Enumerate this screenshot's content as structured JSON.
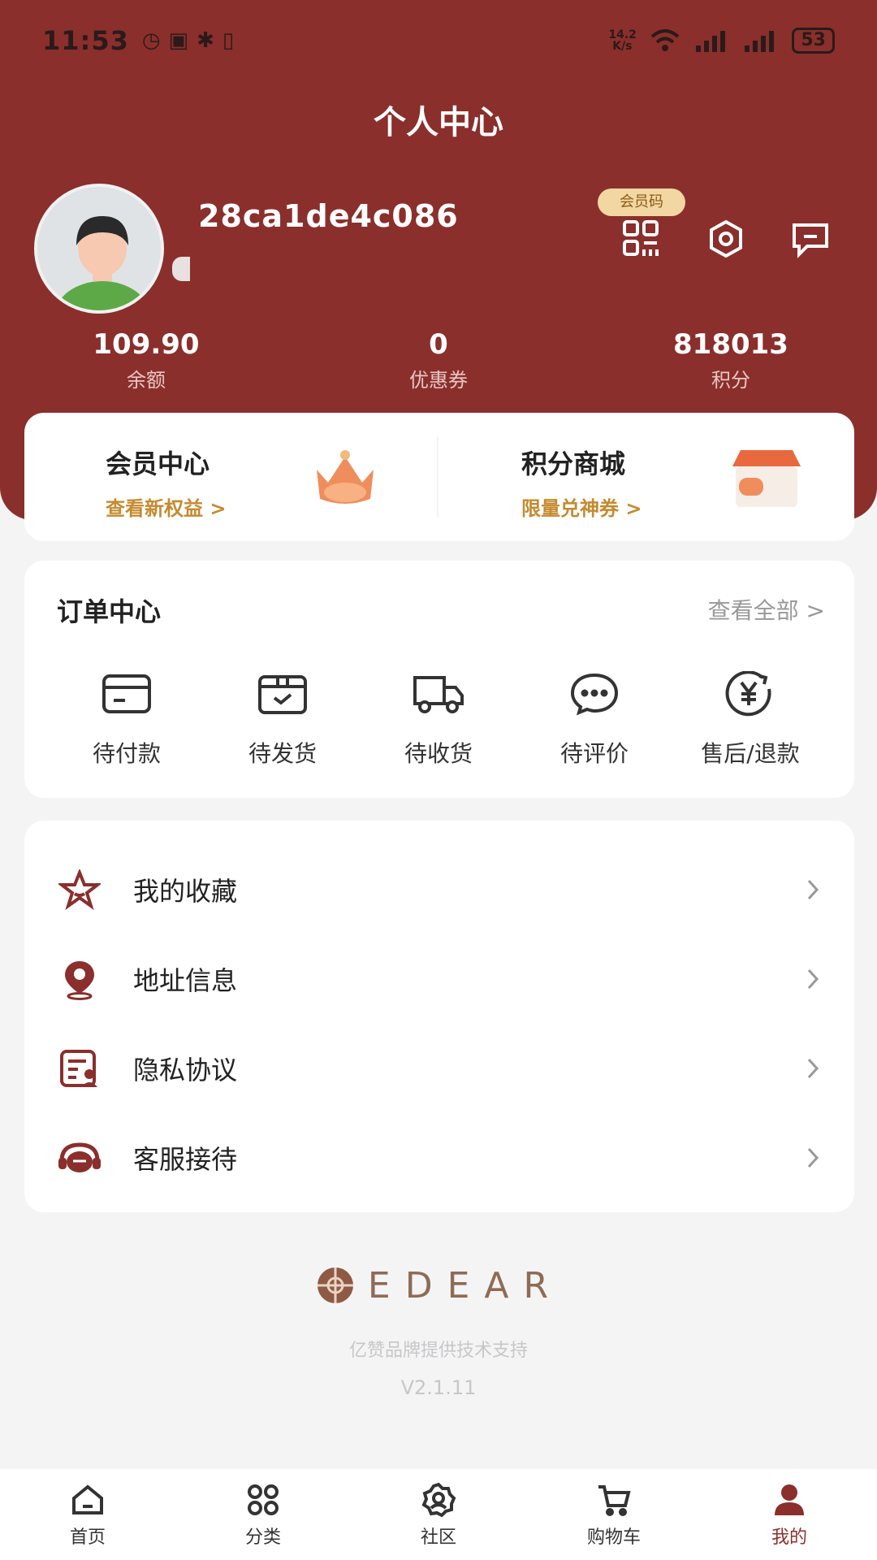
{
  "status_bar": {
    "time": "11:53",
    "network_speed": "14.2 K/s",
    "battery": "53"
  },
  "header": {
    "title": "个人中心"
  },
  "profile": {
    "username": "28ca1de4c086",
    "member_code_label": "会员码"
  },
  "stats": [
    {
      "value": "109.90",
      "label": "余额"
    },
    {
      "value": "0",
      "label": "优惠券"
    },
    {
      "value": "818013",
      "label": "积分"
    }
  ],
  "promos": [
    {
      "title": "会员中心",
      "subtitle": "查看新权益 >"
    },
    {
      "title": "积分商城",
      "subtitle": "限量兑神券 >"
    }
  ],
  "orders": {
    "title": "订单中心",
    "view_all": "查看全部 >",
    "items": [
      {
        "label": "待付款",
        "icon": "card-icon"
      },
      {
        "label": "待发货",
        "icon": "box-icon"
      },
      {
        "label": "待收货",
        "icon": "truck-icon"
      },
      {
        "label": "待评价",
        "icon": "chat-icon"
      },
      {
        "label": "售后/退款",
        "icon": "yen-refund-icon"
      }
    ]
  },
  "menu": [
    {
      "label": "我的收藏",
      "icon": "star-icon"
    },
    {
      "label": "地址信息",
      "icon": "location-pin-icon"
    },
    {
      "label": "隐私协议",
      "icon": "document-user-icon"
    },
    {
      "label": "客服接待",
      "icon": "headset-icon"
    }
  ],
  "footer": {
    "brand": "EDEAR",
    "support": "亿赞品牌提供技术支持",
    "version": "V2.1.11"
  },
  "tab_bar": [
    {
      "label": "首页",
      "icon": "home-icon"
    },
    {
      "label": "分类",
      "icon": "grid-icon"
    },
    {
      "label": "社区",
      "icon": "community-icon"
    },
    {
      "label": "购物车",
      "icon": "cart-icon"
    },
    {
      "label": "我的",
      "icon": "user-icon",
      "active": true
    }
  ],
  "colors": {
    "brand": "#8a2f2c",
    "accent_gold": "#c58a2e",
    "background": "#f4f4f5"
  }
}
